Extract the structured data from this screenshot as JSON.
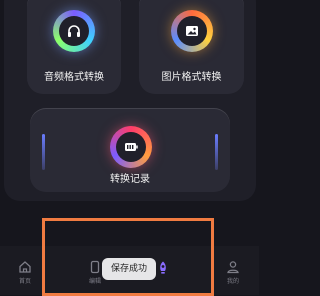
{
  "tools": {
    "audio": {
      "label": "音频格式转换",
      "icon": "headphones-icon"
    },
    "image": {
      "label": "图片格式转换",
      "icon": "image-icon"
    },
    "record": {
      "label": "转换记录",
      "icon": "record-icon"
    }
  },
  "nav": {
    "items": [
      {
        "label": "首页",
        "icon": "home-icon"
      },
      {
        "label": "编辑",
        "icon": "phone-icon"
      },
      {
        "label": "",
        "icon": "rocket-icon"
      },
      {
        "label": "我的",
        "icon": "user-icon"
      }
    ]
  },
  "toast": {
    "text": "保存成功"
  },
  "colors": {
    "highlight": "#f07b41",
    "background": "#16161d"
  }
}
